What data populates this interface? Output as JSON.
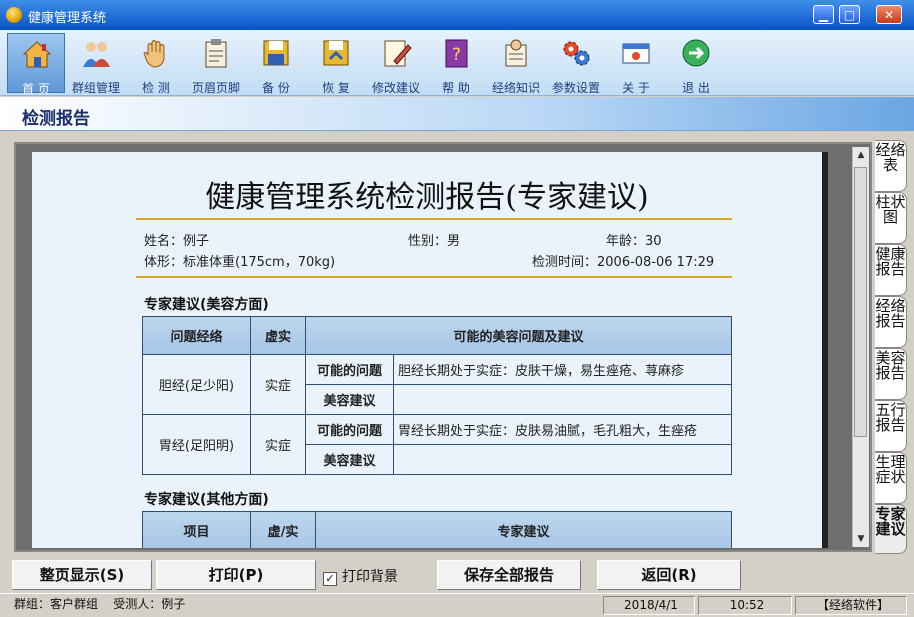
{
  "window": {
    "title": "健康管理系统"
  },
  "toolbar": {
    "items": [
      {
        "label": "首 页",
        "icon": "home-icon"
      },
      {
        "label": "群组管理",
        "icon": "group-icon"
      },
      {
        "label": "检 测",
        "icon": "hand-icon"
      },
      {
        "label": "页眉页脚",
        "icon": "clipboard-icon"
      },
      {
        "label": "备 份",
        "icon": "backup-icon"
      },
      {
        "label": "恢 复",
        "icon": "restore-icon"
      },
      {
        "label": "修改建议",
        "icon": "edit-icon"
      },
      {
        "label": "帮 助",
        "icon": "help-book-icon"
      },
      {
        "label": "经络知识",
        "icon": "knowledge-icon"
      },
      {
        "label": "参数设置",
        "icon": "gears-icon"
      },
      {
        "label": "关 于",
        "icon": "about-icon"
      },
      {
        "label": "退 出",
        "icon": "exit-icon"
      }
    ]
  },
  "section": {
    "title": "检测报告"
  },
  "report": {
    "title": "健康管理系统检测报告(专家建议)",
    "name": "姓名：例子",
    "gender": "性别：男",
    "age": "年龄：30",
    "body": "体形：标准体重(175cm，70kg)",
    "time": "检测时间：2006-08-06 17:29",
    "beauty_heading": "专家建议(美容方面)",
    "beauty_table": {
      "headers": [
        "问题经络",
        "虚实",
        "可能的美容问题及建议"
      ],
      "rows": [
        {
          "meridian": "胆经(足少阳)",
          "state": "实症",
          "problem_label": "可能的问题",
          "problem": "胆经长期处于实症：皮肤干燥，易生痤疮、荨麻疹",
          "advice_label": "美容建议",
          "advice": ""
        },
        {
          "meridian": "胃经(足阳明)",
          "state": "实症",
          "problem_label": "可能的问题",
          "problem": "胃经长期处于实症：皮肤易油腻，毛孔粗大，生痤疮",
          "advice_label": "美容建议",
          "advice": ""
        }
      ]
    },
    "other_heading": "专家建议(其他方面)",
    "other_table": {
      "headers": [
        "项目",
        "虚/实",
        "专家建议"
      ]
    }
  },
  "side_tabs": [
    {
      "label": "经络表",
      "active": false
    },
    {
      "label": "柱状图",
      "active": false
    },
    {
      "label": "健康报告",
      "active": false
    },
    {
      "label": "经络报告",
      "active": false
    },
    {
      "label": "美容报告",
      "active": false
    },
    {
      "label": "五行报告",
      "active": false
    },
    {
      "label": "生理症状",
      "active": false
    },
    {
      "label": "专家建议",
      "active": true
    }
  ],
  "buttons": {
    "fullpage": "整页显示(S)",
    "print": "打印(P)",
    "print_bg": "打印背景",
    "print_bg_checked": "✓",
    "save_all": "保存全部报告",
    "back": "返回(R)"
  },
  "status": {
    "group": "群组：客户群组",
    "person": "受测人：例子",
    "date": "2018/4/1",
    "time": "10:52",
    "brand": "【经络软件】"
  }
}
